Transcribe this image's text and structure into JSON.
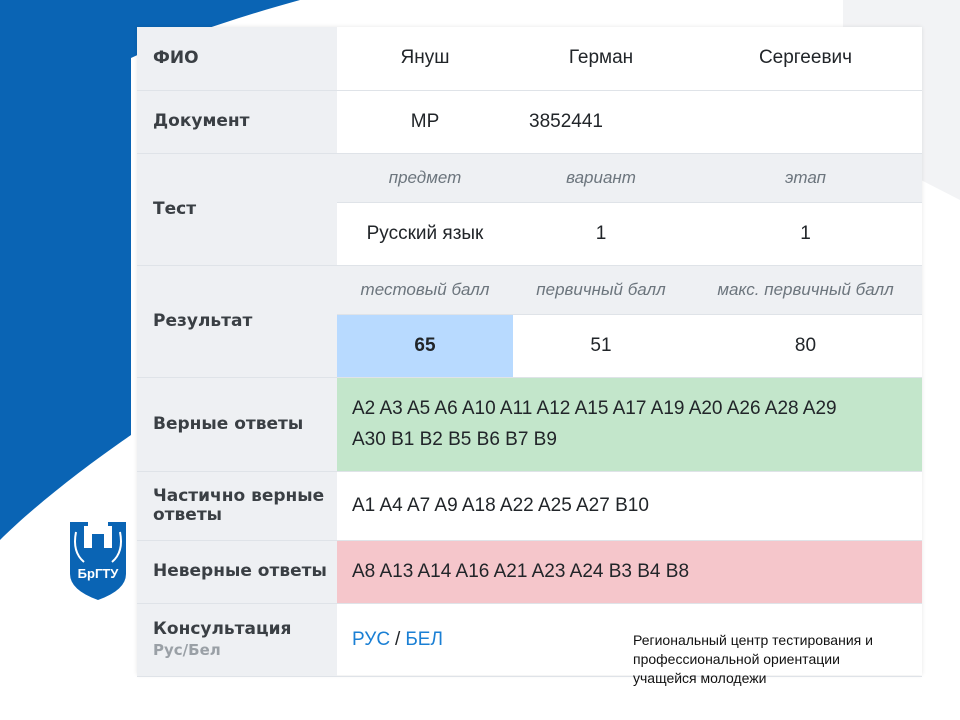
{
  "colors": {
    "brand_blue": "#0a64b4",
    "correct_bg": "#c3e6cb",
    "partial_bg": "#ffffff",
    "wrong_bg": "#f5c6cb",
    "score_bg": "#b8daff",
    "link": "#1a7fd4"
  },
  "logo": {
    "text": "БрГТУ"
  },
  "fio": {
    "label": "ФИО",
    "last_name": "Януш",
    "first_name": "Герман",
    "patronymic": "Сергеевич"
  },
  "document": {
    "label": "Документ",
    "series": "МР",
    "number": "3852441"
  },
  "test": {
    "label": "Тест",
    "headers": {
      "subject": "предмет",
      "variant": "вариант",
      "stage": "этап"
    },
    "subject": "Русский язык",
    "variant": "1",
    "stage": "1"
  },
  "result": {
    "label": "Результат",
    "headers": {
      "test_score": "тестовый балл",
      "primary_score": "первичный балл",
      "max_primary_score": "макс. первичный балл"
    },
    "test_score": "65",
    "primary_score": "51",
    "max_primary_score": "80"
  },
  "correct": {
    "label": "Верные ответы",
    "line1": "A2 A3 A5 A6 A10 A11 A12 A15 A17 A19 A20 A26 A28 A29",
    "line2": "A30 B1 B2 B5 B6 B7 B9"
  },
  "partial": {
    "label_line1": "Частично верные",
    "label_line2": "ответы",
    "answers": "A1 A4 A7 A9 A18 A22 A25 A27 B10"
  },
  "wrong": {
    "label": "Неверные ответы",
    "answers": "A8 A13 A14 A16 A21 A23 A24 B3 B4 B8"
  },
  "consultation": {
    "label": "Консультация",
    "sublabel": "Рус/Бел",
    "link_rus": "РУС",
    "separator": "/",
    "link_bel": "БЕЛ"
  },
  "footer": {
    "line1": "Региональный центр тестирования и",
    "line2": "профессиональной ориентации",
    "line3": "учащейся молодежи"
  }
}
